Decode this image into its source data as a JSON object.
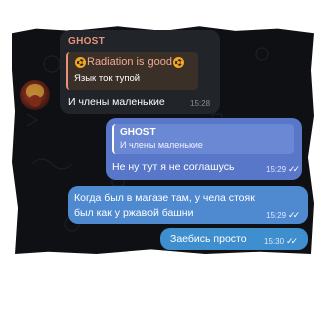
{
  "incoming": {
    "sender": "GHOST",
    "reply": {
      "title": "Radiation is good",
      "text": "Язык ток тупой"
    },
    "text": "И члены маленькие",
    "time": "15:28"
  },
  "outgoing": [
    {
      "reply_name": "GHOST",
      "reply_text": "И члены маленькие",
      "text": "Не ну тут я не соглашусь",
      "time": "15:29"
    },
    {
      "text_line1": "Когда был в магазе там, у чела стояк",
      "text_line2": "был как у ржавой башни",
      "time": "15:29"
    },
    {
      "text": "Заебись просто",
      "time": "15:30"
    }
  ],
  "icons": {
    "reply_title_decoration": "radiation-icon",
    "read_status": "double-check-icon"
  },
  "colors": {
    "background": "#0e1014",
    "incoming_bubble": "#212429",
    "sender_name": "#e8927d",
    "outgoing_bubble": "#5877c9"
  }
}
